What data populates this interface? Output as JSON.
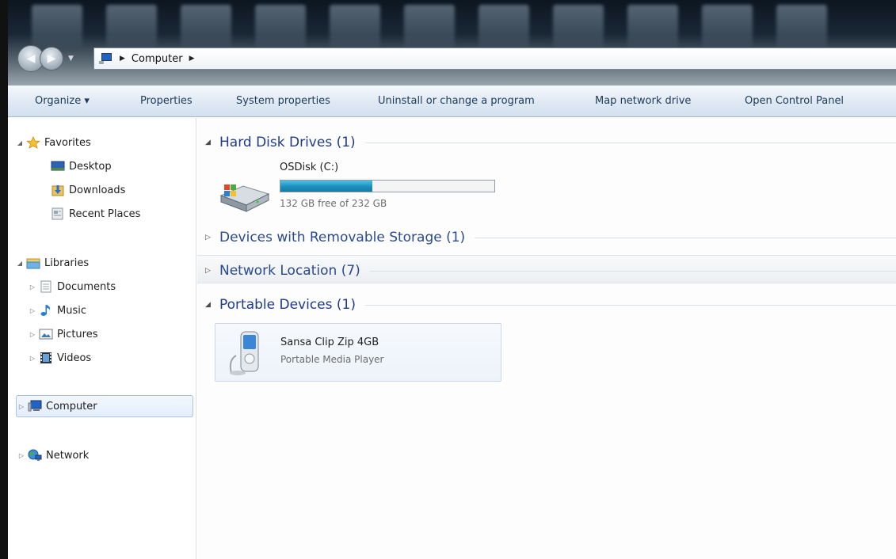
{
  "address": {
    "crumbs": [
      "Computer"
    ]
  },
  "toolbar": {
    "organize": "Organize ▾",
    "properties": "Properties",
    "system_properties": "System properties",
    "uninstall": "Uninstall or change a program",
    "map_drive": "Map network drive",
    "control_panel": "Open Control Panel"
  },
  "sidebar": {
    "favorites": {
      "label": "Favorites",
      "items": [
        "Desktop",
        "Downloads",
        "Recent Places"
      ]
    },
    "libraries": {
      "label": "Libraries",
      "items": [
        "Documents",
        "Music",
        "Pictures",
        "Videos"
      ]
    },
    "computer": "Computer",
    "network": "Network"
  },
  "content": {
    "groups": {
      "hdd": "Hard Disk Drives (1)",
      "removable": "Devices with Removable Storage (1)",
      "network": "Network Location (7)",
      "portable": "Portable Devices (1)"
    },
    "drive": {
      "name": "OSDisk (C:)",
      "free_text": "132 GB free of 232 GB",
      "used_fraction": 0.431
    },
    "device": {
      "name": "Sansa Clip Zip 4GB",
      "type": "Portable Media Player"
    }
  },
  "colors": {
    "group_title": "#1e3a8a",
    "toolbar_text": "#1c3b5a",
    "drive_bar": "#1d8fbf",
    "selection": "#e3eefb"
  }
}
